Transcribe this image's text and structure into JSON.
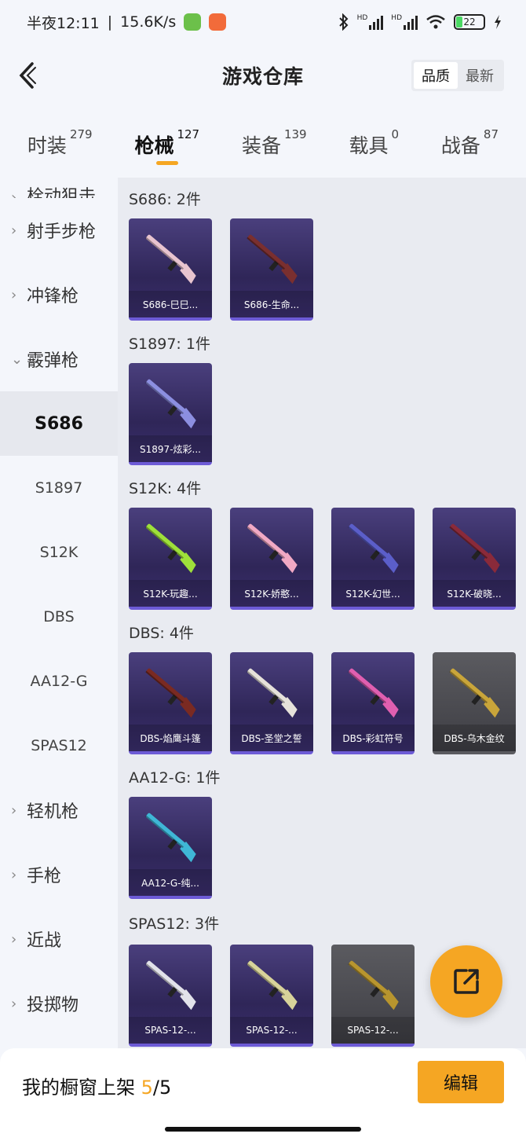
{
  "status_bar": {
    "time": "半夜12:11",
    "speed": "15.6K/s",
    "battery": "22",
    "hd1": "HD",
    "hd2": "HD"
  },
  "header": {
    "title": "游戏仓库",
    "sort_options": [
      "品质",
      "最新"
    ]
  },
  "tabs": [
    {
      "label": "时装",
      "count": "279"
    },
    {
      "label": "枪械",
      "count": "127"
    },
    {
      "label": "装备",
      "count": "139"
    },
    {
      "label": "载具",
      "count": "0"
    },
    {
      "label": "战备",
      "count": "87"
    }
  ],
  "sidebar": {
    "items": [
      {
        "label": "栓动狙击",
        "type": "cat"
      },
      {
        "label": "射手步枪",
        "type": "cat"
      },
      {
        "label": "冲锋枪",
        "type": "cat"
      },
      {
        "label": "霰弹枪",
        "type": "cat-open"
      },
      {
        "label": "S686",
        "type": "sub-active"
      },
      {
        "label": "S1897",
        "type": "sub"
      },
      {
        "label": "S12K",
        "type": "sub"
      },
      {
        "label": "DBS",
        "type": "sub"
      },
      {
        "label": "AA12-G",
        "type": "sub"
      },
      {
        "label": "SPAS12",
        "type": "sub"
      },
      {
        "label": "轻机枪",
        "type": "cat"
      },
      {
        "label": "手枪",
        "type": "cat"
      },
      {
        "label": "近战",
        "type": "cat"
      },
      {
        "label": "投掷物",
        "type": "cat"
      }
    ]
  },
  "groups": [
    {
      "title": "S686: 2件",
      "items": [
        {
          "name": "S686-巳巳...",
          "color": "#e8c4cf",
          "quality": "purple"
        },
        {
          "name": "S686-生命...",
          "color": "#7a2f2f",
          "quality": "purple"
        }
      ]
    },
    {
      "title": "S1897: 1件",
      "items": [
        {
          "name": "S1897-炫彩...",
          "color": "#8c8fe0",
          "quality": "purple"
        }
      ]
    },
    {
      "title": "S12K: 4件",
      "items": [
        {
          "name": "S12K-玩趣...",
          "color": "#9ee03a",
          "quality": "purple"
        },
        {
          "name": "S12K-娇憨...",
          "color": "#f1a9c4",
          "quality": "purple"
        },
        {
          "name": "S12K-幻世...",
          "color": "#5b5ec9",
          "quality": "purple"
        },
        {
          "name": "S12K-破晓...",
          "color": "#8a2a3a",
          "quality": "purple"
        }
      ]
    },
    {
      "title": "DBS: 4件",
      "items": [
        {
          "name": "DBS-焰鹰斗篷",
          "color": "#7a2a22",
          "quality": "purple"
        },
        {
          "name": "DBS-圣堂之誓",
          "color": "#e6e2da",
          "quality": "purple"
        },
        {
          "name": "DBS-彩虹符号",
          "color": "#e05fb0",
          "quality": "purple"
        },
        {
          "name": "DBS-乌木金纹",
          "color": "#c9a53a",
          "quality": "gray"
        }
      ]
    },
    {
      "title": "AA12-G: 1件",
      "items": [
        {
          "name": "AA12-G-纯...",
          "color": "#3fb7d6",
          "quality": "purple"
        }
      ]
    },
    {
      "title": "SPAS12: 3件",
      "items": [
        {
          "name": "SPAS-12-...",
          "color": "#e2e2ea",
          "quality": "purple"
        },
        {
          "name": "SPAS-12-...",
          "color": "#d8d39a",
          "quality": "purple"
        },
        {
          "name": "SPAS-12-...",
          "color": "#b8952e",
          "quality": "gray"
        }
      ]
    }
  ],
  "bottom_bar": {
    "prefix": "我的橱窗上架 ",
    "current": "5",
    "total": "/5",
    "edit_label": "编辑"
  },
  "colors": {
    "accent": "#f5a623",
    "purple_card": "#3b2f6e",
    "gray_card": "#4a4a50"
  },
  "icons": {
    "back": "back-arrow-icon",
    "share": "share-external-icon"
  }
}
